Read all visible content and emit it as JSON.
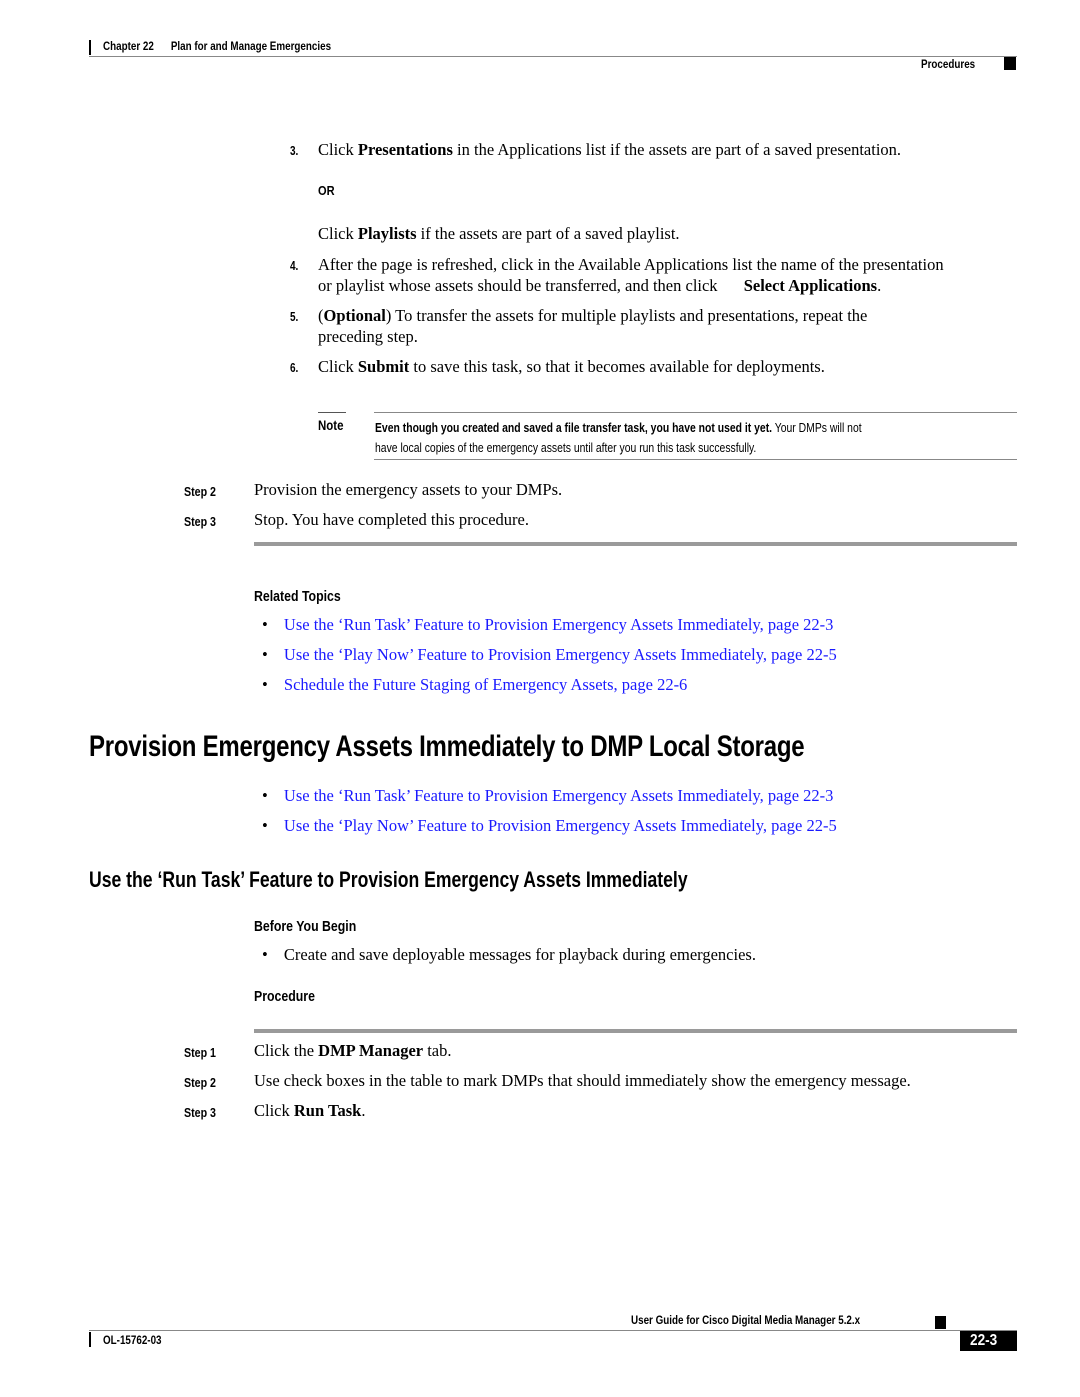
{
  "header": {
    "chapter": "Chapter 22",
    "chapter_title": "Plan for and Manage Emergencies",
    "section": "Procedures"
  },
  "substeps": [
    {
      "num": "3.",
      "pre": "Click ",
      "bold": "Presentations",
      "post": " in the Applications list if the assets are part of a saved presentation."
    },
    {
      "or_label": "OR"
    },
    {
      "pre": "Click ",
      "bold": "Playlists",
      "post": " if the assets are part of a saved playlist."
    },
    {
      "num": "4.",
      "line1": "After the page is refreshed, click in the Available Applications list the name of the presentation",
      "line2_pre": "or playlist whose assets should be transferred, and then click ",
      "line2_bold": "Select Applications",
      "line2_post": "."
    },
    {
      "num": "5.",
      "pre": "(",
      "bold": "Optional",
      "post": ") To transfer the assets for multiple playlists and presentations, repeat the",
      "line2": "preceding step."
    },
    {
      "num": "6.",
      "pre": "Click ",
      "bold": "Submit",
      "post": " to save this task, so that it becomes available for deployments."
    }
  ],
  "note": {
    "label": "Note",
    "bold": "Even though you created and saved a file transfer task, you have not used it yet.",
    "text1": " Your DMPs will not",
    "text2": "have local copies of the emergency assets until after you run this task successfully."
  },
  "steps_a": [
    {
      "label": "Step 2",
      "text": "Provision the emergency assets to your DMPs."
    },
    {
      "label": "Step 3",
      "text": "Stop. You have completed this procedure."
    }
  ],
  "related_topics": {
    "heading": "Related Topics",
    "links": [
      "Use the ‘Run Task’ Feature to Provision Emergency Assets Immediately, page 22-3",
      "Use the ‘Play Now’ Feature to Provision Emergency Assets Immediately, page 22-5",
      "Schedule the Future Staging of Emergency Assets, page 22-6"
    ]
  },
  "section1": {
    "title": "Provision Emergency Assets Immediately to DMP Local Storage",
    "links": [
      "Use the ‘Run Task’ Feature to Provision Emergency Assets Immediately, page 22-3",
      "Use the ‘Play Now’ Feature to Provision Emergency Assets Immediately, page 22-5"
    ]
  },
  "section2": {
    "title": "Use the ‘Run Task’ Feature to Provision Emergency Assets Immediately",
    "before_heading": "Before You Begin",
    "before_items": [
      "Create and save deployable messages for playback during emergencies."
    ],
    "procedure_heading": "Procedure",
    "steps": [
      {
        "label": "Step 1",
        "pre": "Click the ",
        "bold": "DMP Manager",
        "post": " tab."
      },
      {
        "label": "Step 2",
        "pre": "Use check boxes in the table to mark DMPs that should immediately show the emergency message.",
        "bold": "",
        "post": ""
      },
      {
        "label": "Step 3",
        "pre": "Click ",
        "bold": "Run Task",
        "post": "."
      }
    ]
  },
  "footer": {
    "guide_title": "User Guide for Cisco Digital Media Manager 5.2.x",
    "doc_number": "OL-15762-03",
    "page_number": "22-3"
  },
  "bullet_char": "•"
}
